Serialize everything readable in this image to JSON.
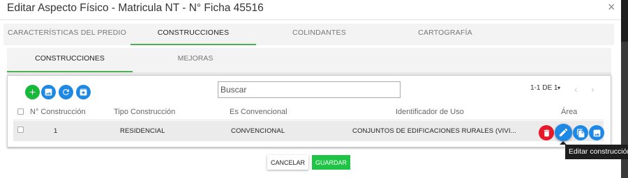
{
  "dialog": {
    "title": "Editar Aspecto Físico - Matricula NT - N° Ficha 45516",
    "close_glyph": "×"
  },
  "main_tabs": [
    {
      "label": "CARACTERÍSTICAS DEL PREDIO",
      "active": false
    },
    {
      "label": "CONSTRUCCIONES",
      "active": true
    },
    {
      "label": "COLINDANTES",
      "active": false
    },
    {
      "label": "CARTOGRAFÍA",
      "active": false
    }
  ],
  "sub_tabs": [
    {
      "label": "CONSTRUCCIONES",
      "active": true
    },
    {
      "label": "MEJORAS",
      "active": false
    }
  ],
  "toolbar": {
    "buttons": [
      {
        "icon": "add-icon",
        "color": "#18b83a"
      },
      {
        "icon": "image-icon",
        "color": "#1e88e5"
      },
      {
        "icon": "refresh-icon",
        "color": "#1e88e5"
      },
      {
        "icon": "archive-icon",
        "color": "#1e88e5"
      }
    ],
    "search_placeholder": "Buscar",
    "pager_text": "1-1 DE 1",
    "pager_caret": "▾",
    "prev_glyph": "‹",
    "next_glyph": "›"
  },
  "table": {
    "columns": [
      "N° Construcción",
      "Tipo Construcción",
      "Es Convencional",
      "Identificador de Uso",
      "Área"
    ],
    "rows": [
      {
        "numero": "1",
        "tipo": "RESIDENCIAL",
        "convencional": "CONVENCIONAL",
        "uso": "CONJUNTOS DE EDIFICACIONES RURALES (VIVI...",
        "area": ""
      }
    ],
    "row_actions": [
      {
        "icon": "delete-icon",
        "color": "#e5192a"
      },
      {
        "icon": "edit-icon",
        "color": "#1e88e5"
      },
      {
        "icon": "copy-icon",
        "color": "#1e88e5"
      },
      {
        "icon": "image-icon",
        "color": "#1e88e5"
      }
    ]
  },
  "tooltip": {
    "text": "Editar construcción"
  },
  "footer": {
    "cancel_label": "CANCELAR",
    "save_label": "GUARDAR"
  },
  "colors": {
    "accent_green": "#4caf50",
    "save_green": "#1ec545",
    "primary_blue": "#1e88e5",
    "danger_red": "#e5192a"
  }
}
